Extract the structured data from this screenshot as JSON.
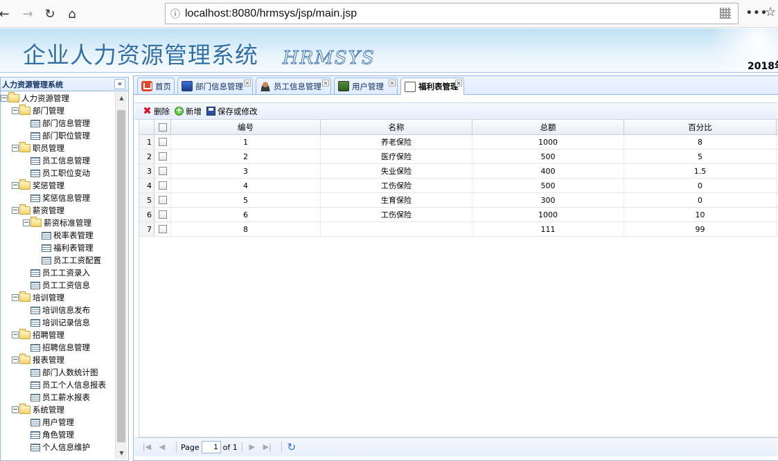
{
  "browser": {
    "url": "localhost:8080/hrmsys/jsp/main.jsp"
  },
  "banner": {
    "title": "企业人力资源管理系统",
    "subtitle": "HRMSYS",
    "date": "2018年"
  },
  "sidebar": {
    "title": "人力资源管理系统",
    "tree": [
      {
        "label": "人力资源管理",
        "level": 0,
        "type": "folder"
      },
      {
        "label": "部门管理",
        "level": 1,
        "type": "folder"
      },
      {
        "label": "部门信息管理",
        "level": 2,
        "type": "file"
      },
      {
        "label": "部门职位管理",
        "level": 2,
        "type": "file"
      },
      {
        "label": "职员管理",
        "level": 1,
        "type": "folder"
      },
      {
        "label": "员工信息管理",
        "level": 2,
        "type": "file"
      },
      {
        "label": "员工职位变动",
        "level": 2,
        "type": "file"
      },
      {
        "label": "奖惩管理",
        "level": 1,
        "type": "folder"
      },
      {
        "label": "奖惩信息管理",
        "level": 2,
        "type": "file"
      },
      {
        "label": "薪资管理",
        "level": 1,
        "type": "folder"
      },
      {
        "label": "薪资标准管理",
        "level": 2,
        "type": "folder"
      },
      {
        "label": "税率表管理",
        "level": 3,
        "type": "file"
      },
      {
        "label": "福利表管理",
        "level": 3,
        "type": "file"
      },
      {
        "label": "员工工资配置",
        "level": 3,
        "type": "file"
      },
      {
        "label": "员工工资录入",
        "level": 2,
        "type": "file"
      },
      {
        "label": "员工工资信息",
        "level": 2,
        "type": "file"
      },
      {
        "label": "培训管理",
        "level": 1,
        "type": "folder"
      },
      {
        "label": "培训信息发布",
        "level": 2,
        "type": "file"
      },
      {
        "label": "培训记录信息",
        "level": 2,
        "type": "file"
      },
      {
        "label": "招聘管理",
        "level": 1,
        "type": "folder"
      },
      {
        "label": "招聘信息管理",
        "level": 2,
        "type": "file"
      },
      {
        "label": "报表管理",
        "level": 1,
        "type": "folder"
      },
      {
        "label": "部门人数统计图",
        "level": 2,
        "type": "file"
      },
      {
        "label": "员工个人信息报表",
        "level": 2,
        "type": "file"
      },
      {
        "label": "员工薪水报表",
        "level": 2,
        "type": "file"
      },
      {
        "label": "系统管理",
        "level": 1,
        "type": "folder"
      },
      {
        "label": "用户管理",
        "level": 2,
        "type": "file"
      },
      {
        "label": "角色管理",
        "level": 2,
        "type": "file"
      },
      {
        "label": "个人信息维护",
        "level": 2,
        "type": "file"
      }
    ]
  },
  "tabs": [
    {
      "label": "首页",
      "icon": "home-icon",
      "closable": false,
      "active": false
    },
    {
      "label": "部门信息管理",
      "icon": "monitor-icon",
      "closable": true,
      "active": false
    },
    {
      "label": "员工信息管理",
      "icon": "user-icon",
      "closable": true,
      "active": false
    },
    {
      "label": "用户管理",
      "icon": "users-icon",
      "closable": true,
      "active": false
    },
    {
      "label": "福利表管理",
      "icon": "sheet-icon",
      "closable": true,
      "active": true
    }
  ],
  "toolbar": {
    "delete_label": "删除",
    "add_label": "新增",
    "save_label": "保存或修改"
  },
  "grid": {
    "columns": [
      "编号",
      "名称",
      "总额",
      "百分比"
    ],
    "rows": [
      {
        "num": "1",
        "id": "1",
        "name": "养老保险",
        "total": "1000",
        "percent": "8"
      },
      {
        "num": "2",
        "id": "2",
        "name": "医疗保险",
        "total": "500",
        "percent": "5"
      },
      {
        "num": "3",
        "id": "3",
        "name": "失业保险",
        "total": "400",
        "percent": "1.5"
      },
      {
        "num": "4",
        "id": "4",
        "name": "工伤保险",
        "total": "500",
        "percent": "0"
      },
      {
        "num": "5",
        "id": "5",
        "name": "生育保险",
        "total": "300",
        "percent": "0"
      },
      {
        "num": "6",
        "id": "6",
        "name": "工伤保险",
        "total": "1000",
        "percent": "10"
      },
      {
        "num": "7",
        "id": "8",
        "name": "",
        "total": "111",
        "percent": "99"
      }
    ]
  },
  "pager": {
    "page_label": "Page",
    "page_value": "1",
    "of_label": "of 1"
  }
}
